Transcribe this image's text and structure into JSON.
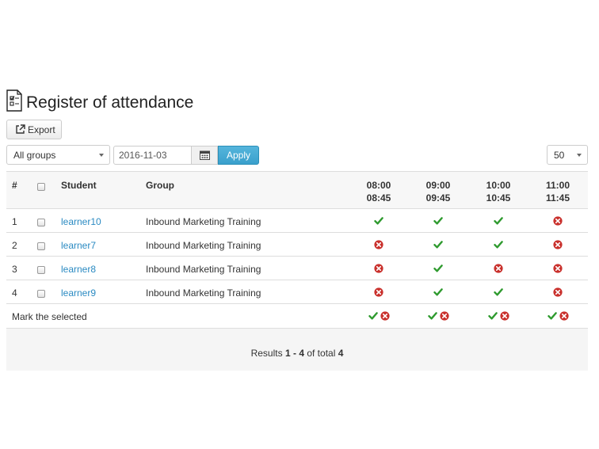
{
  "page_title": "Register of attendance",
  "toolbar": {
    "export_label": "Export"
  },
  "filters": {
    "group_selected": "All groups",
    "date_value": "2016-11-03",
    "apply_label": "Apply",
    "per_page": "50"
  },
  "table": {
    "headers": {
      "num": "#",
      "student": "Student",
      "group": "Group",
      "slots": [
        {
          "start": "08:00",
          "end": "08:45"
        },
        {
          "start": "09:00",
          "end": "09:45"
        },
        {
          "start": "10:00",
          "end": "10:45"
        },
        {
          "start": "11:00",
          "end": "11:45"
        }
      ]
    },
    "rows": [
      {
        "num": "1",
        "student": "learner10",
        "group": "Inbound Marketing Training",
        "attendance": [
          "present",
          "present",
          "present",
          "absent"
        ]
      },
      {
        "num": "2",
        "student": "learner7",
        "group": "Inbound Marketing Training",
        "attendance": [
          "absent",
          "present",
          "present",
          "absent"
        ]
      },
      {
        "num": "3",
        "student": "learner8",
        "group": "Inbound Marketing Training",
        "attendance": [
          "absent",
          "present",
          "absent",
          "absent"
        ]
      },
      {
        "num": "4",
        "student": "learner9",
        "group": "Inbound Marketing Training",
        "attendance": [
          "absent",
          "present",
          "present",
          "absent"
        ]
      }
    ],
    "footer_label": "Mark the selected"
  },
  "results": {
    "prefix": "Results",
    "from": "1",
    "separator": "-",
    "to": "4",
    "middle": "of total",
    "total": "4"
  },
  "colors": {
    "present": "#2e9a2e",
    "absent": "#c9302c",
    "link": "#2a8ac2",
    "apply": "#3aa0cc"
  },
  "icons": {
    "title": "attendance-sheet-icon",
    "export": "export-icon",
    "calendar": "calendar-icon",
    "present": "check-icon",
    "absent": "cross-circle-icon"
  }
}
